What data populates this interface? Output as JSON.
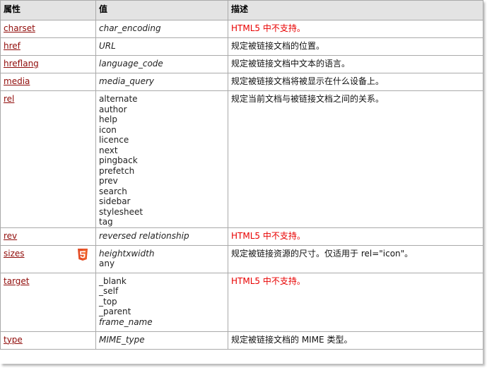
{
  "headers": {
    "attr": "属性",
    "value": "值",
    "desc": "描述"
  },
  "rows": [
    {
      "attr": "charset",
      "values": [
        {
          "text": "char_encoding",
          "italic": true
        }
      ],
      "desc": "HTML5 中不支持。",
      "red": true
    },
    {
      "attr": "href",
      "values": [
        {
          "text": "URL",
          "italic": true
        }
      ],
      "desc": "规定被链接文档的位置。",
      "red": false
    },
    {
      "attr": "hreflang",
      "values": [
        {
          "text": "language_code",
          "italic": true
        }
      ],
      "desc": "规定被链接文档中文本的语言。",
      "red": false
    },
    {
      "attr": "media",
      "values": [
        {
          "text": "media_query",
          "italic": true
        }
      ],
      "desc": "规定被链接文档将被显示在什么设备上。",
      "red": false
    },
    {
      "attr": "rel",
      "values": [
        {
          "text": "alternate",
          "italic": false
        },
        {
          "text": "author",
          "italic": false
        },
        {
          "text": "help",
          "italic": false
        },
        {
          "text": "icon",
          "italic": false
        },
        {
          "text": "licence",
          "italic": false
        },
        {
          "text": "next",
          "italic": false
        },
        {
          "text": "pingback",
          "italic": false
        },
        {
          "text": "prefetch",
          "italic": false
        },
        {
          "text": "prev",
          "italic": false
        },
        {
          "text": "search",
          "italic": false
        },
        {
          "text": "sidebar",
          "italic": false
        },
        {
          "text": "stylesheet",
          "italic": false
        },
        {
          "text": "tag",
          "italic": false
        }
      ],
      "desc": "规定当前文档与被链接文档之间的关系。",
      "red": false
    },
    {
      "attr": "rev",
      "values": [
        {
          "text": "reversed relationship",
          "italic": true
        }
      ],
      "desc": "HTML5 中不支持。",
      "red": true
    },
    {
      "attr": "sizes",
      "html5": true,
      "values": [
        {
          "text": "heightxwidth",
          "italic": true
        },
        {
          "text": "any",
          "italic": false
        }
      ],
      "desc": "规定被链接资源的尺寸。仅适用于 rel=\"icon\"。",
      "red": false
    },
    {
      "attr": "target",
      "values": [
        {
          "text": "_blank",
          "italic": false
        },
        {
          "text": "_self",
          "italic": false
        },
        {
          "text": "_top",
          "italic": false
        },
        {
          "text": "_parent",
          "italic": false
        },
        {
          "text": "frame_name",
          "italic": true
        }
      ],
      "desc": "HTML5 中不支持。",
      "red": true
    },
    {
      "attr": "type",
      "values": [
        {
          "text": "MIME_type",
          "italic": true
        }
      ],
      "desc": "规定被链接文档的 MIME 类型。",
      "red": false
    }
  ],
  "colors": {
    "link": "#900b09",
    "unsupported": "#e80000",
    "header_bg": "#e3e3e3",
    "html5_badge": "#e44d26"
  },
  "icons": {
    "html5_badge": "html5-logo-icon"
  }
}
